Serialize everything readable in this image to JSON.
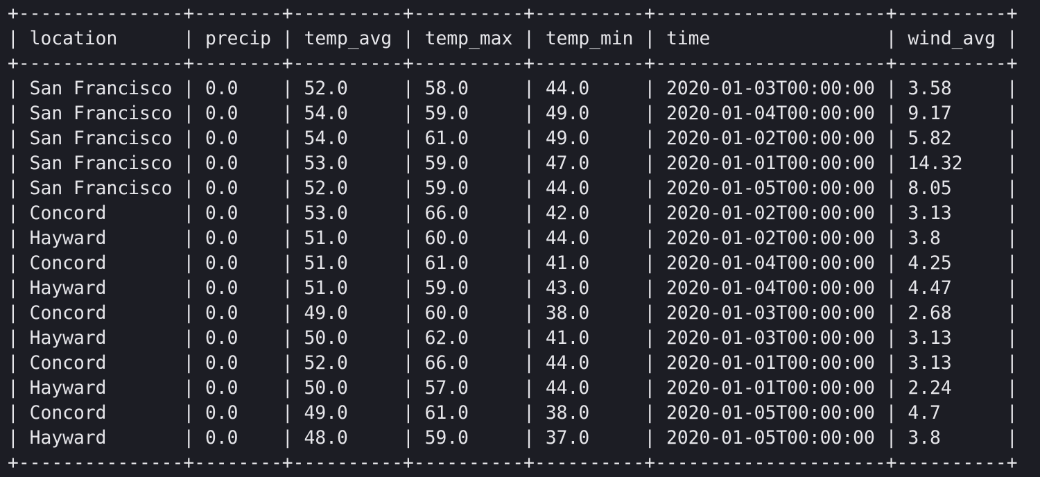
{
  "table": {
    "separator": "+---------------+--------+----------+----------+----------+---------------------+----------+",
    "columns": [
      {
        "key": "location",
        "label": "location",
        "width": 13
      },
      {
        "key": "precip",
        "label": "precip",
        "width": 6
      },
      {
        "key": "temp_avg",
        "label": "temp_avg",
        "width": 8
      },
      {
        "key": "temp_max",
        "label": "temp_max",
        "width": 8
      },
      {
        "key": "temp_min",
        "label": "temp_min",
        "width": 8
      },
      {
        "key": "time",
        "label": "time",
        "width": 19
      },
      {
        "key": "wind_avg",
        "label": "wind_avg",
        "width": 8
      }
    ],
    "rows": [
      [
        "San Francisco",
        "0.0",
        "52.0",
        "58.0",
        "44.0",
        "2020-01-03T00:00:00",
        "3.58"
      ],
      [
        "San Francisco",
        "0.0",
        "54.0",
        "59.0",
        "49.0",
        "2020-01-04T00:00:00",
        "9.17"
      ],
      [
        "San Francisco",
        "0.0",
        "54.0",
        "61.0",
        "49.0",
        "2020-01-02T00:00:00",
        "5.82"
      ],
      [
        "San Francisco",
        "0.0",
        "53.0",
        "59.0",
        "47.0",
        "2020-01-01T00:00:00",
        "14.32"
      ],
      [
        "San Francisco",
        "0.0",
        "52.0",
        "59.0",
        "44.0",
        "2020-01-05T00:00:00",
        "8.05"
      ],
      [
        "Concord",
        "0.0",
        "53.0",
        "66.0",
        "42.0",
        "2020-01-02T00:00:00",
        "3.13"
      ],
      [
        "Hayward",
        "0.0",
        "51.0",
        "60.0",
        "44.0",
        "2020-01-02T00:00:00",
        "3.8"
      ],
      [
        "Concord",
        "0.0",
        "51.0",
        "61.0",
        "41.0",
        "2020-01-04T00:00:00",
        "4.25"
      ],
      [
        "Hayward",
        "0.0",
        "51.0",
        "59.0",
        "43.0",
        "2020-01-04T00:00:00",
        "4.47"
      ],
      [
        "Concord",
        "0.0",
        "49.0",
        "60.0",
        "38.0",
        "2020-01-03T00:00:00",
        "2.68"
      ],
      [
        "Hayward",
        "0.0",
        "50.0",
        "62.0",
        "41.0",
        "2020-01-03T00:00:00",
        "3.13"
      ],
      [
        "Concord",
        "0.0",
        "52.0",
        "66.0",
        "44.0",
        "2020-01-01T00:00:00",
        "3.13"
      ],
      [
        "Hayward",
        "0.0",
        "50.0",
        "57.0",
        "44.0",
        "2020-01-01T00:00:00",
        "2.24"
      ],
      [
        "Concord",
        "0.0",
        "49.0",
        "61.0",
        "38.0",
        "2020-01-05T00:00:00",
        "4.7"
      ],
      [
        "Hayward",
        "0.0",
        "48.0",
        "59.0",
        "37.0",
        "2020-01-05T00:00:00",
        "3.8"
      ]
    ]
  }
}
